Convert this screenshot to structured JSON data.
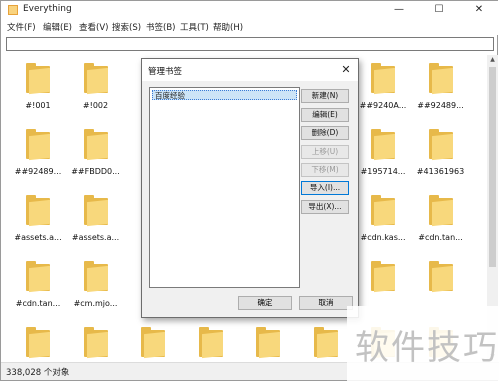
{
  "window": {
    "title": "Everything",
    "controls": {
      "minimize": "—",
      "maximize": "☐",
      "close": "✕"
    }
  },
  "menu": [
    "文件(F)",
    "编辑(E)",
    "查看(V)",
    "搜索(S)",
    "书签(B)",
    "工具(T)",
    "帮助(H)"
  ],
  "search": {
    "value": "",
    "placeholder": ""
  },
  "files": [
    {
      "label": "#!001"
    },
    {
      "label": "#!002"
    },
    {
      "label": ""
    },
    {
      "label": ""
    },
    {
      "label": ""
    },
    {
      "label": ""
    },
    {
      "label": "##9240A..."
    },
    {
      "label": "##92489..."
    },
    {
      "label": "##92489..."
    },
    {
      "label": "##FBDD0..."
    },
    {
      "label": "#"
    },
    {
      "label": ""
    },
    {
      "label": ""
    },
    {
      "label": ""
    },
    {
      "label": "#195714..."
    },
    {
      "label": "#41361963"
    },
    {
      "label": "#assets.a..."
    },
    {
      "label": "#assets.a..."
    },
    {
      "label": "#"
    },
    {
      "label": ""
    },
    {
      "label": ""
    },
    {
      "label": ""
    },
    {
      "label": "#cdn.kas..."
    },
    {
      "label": "#cdn.tan..."
    },
    {
      "label": "#cdn.tan..."
    },
    {
      "label": "#cm.mjo..."
    },
    {
      "label": "#"
    },
    {
      "label": ""
    },
    {
      "label": ""
    },
    {
      "label": ""
    },
    {
      "label": ""
    },
    {
      "label": ""
    },
    {
      "label": ""
    },
    {
      "label": ""
    },
    {
      "label": ""
    },
    {
      "label": ""
    },
    {
      "label": ""
    },
    {
      "label": ""
    },
    {
      "label": ""
    },
    {
      "label": ""
    }
  ],
  "status": {
    "text": "338,028 个对象"
  },
  "dialog": {
    "title": "管理书签",
    "close": "✕",
    "bookmarks": [
      "百度经验"
    ],
    "buttons": {
      "new": "新建(N)",
      "edit": "编辑(E)",
      "delete": "删除(D)",
      "move_up": "上移(U)",
      "move_down": "下移(M)",
      "import": "导入(I)...",
      "export": "导出(X)..."
    },
    "ok": "确定",
    "cancel": "取消"
  },
  "watermark": "软件技巧"
}
